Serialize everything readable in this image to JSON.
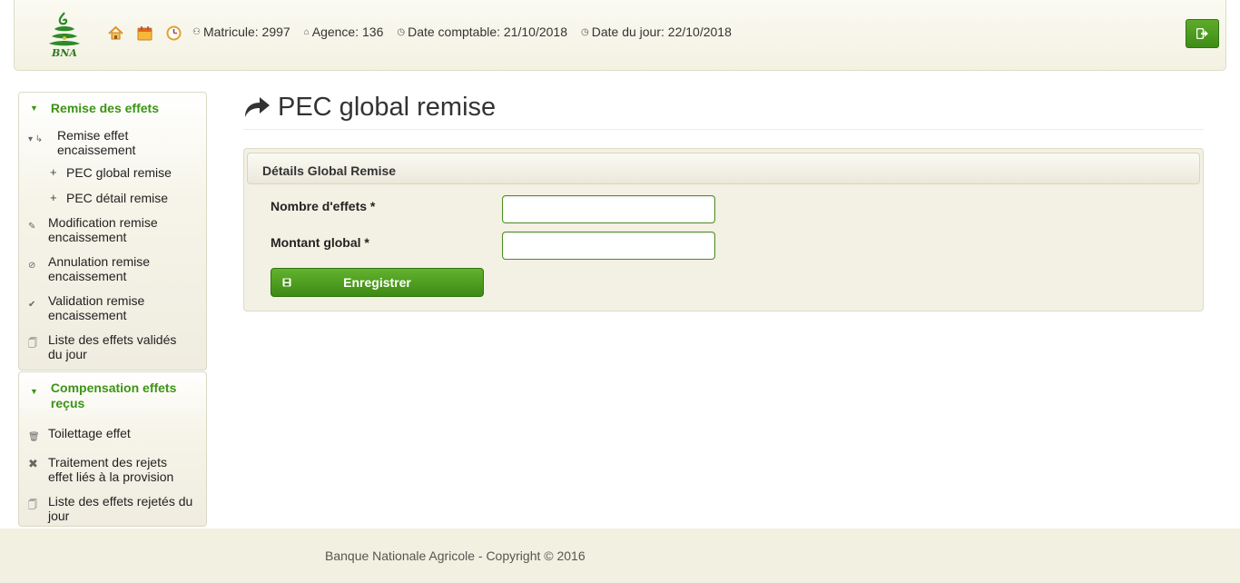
{
  "header": {
    "logo_text": "BNA",
    "icons": [
      "home-icon",
      "calendar-icon",
      "clock-icon"
    ],
    "info": [
      {
        "icon": "user-icon",
        "text": "Matricule: 2997"
      },
      {
        "icon": "bank-icon",
        "text": "Agence: 136"
      },
      {
        "icon": "clock-icon",
        "text": "Date comptable: 21/10/2018"
      },
      {
        "icon": "clock-icon",
        "text": "Date du jour: 22/10/2018"
      }
    ],
    "logout_icon": "logout-icon"
  },
  "sidebar": {
    "section1": {
      "title": "Remise des effets",
      "item_remise": "Remise effet encaissement",
      "sub_global": "PEC global remise",
      "sub_detail": "PEC détail remise",
      "item_modification": "Modification remise encaissement",
      "item_annulation": "Annulation remise encaissement",
      "item_validation": "Validation remise encaissement",
      "item_liste": "Liste des effets validés du jour"
    },
    "section2": {
      "title": "Compensation effets reçus",
      "item_toilettage": "Toilettage effet",
      "item_traitement": "Traitement des rejets effet liés à la provision",
      "item_liste_rejetes": "Liste des effets rejetés du jour"
    }
  },
  "main": {
    "title": "PEC global remise",
    "panel_title": "Détails Global Remise",
    "field_nombre_label": "Nombre d'effets  *",
    "field_nombre_value": "",
    "field_montant_label": "Montant global  *",
    "field_montant_value": "",
    "save_label": "Enregistrer"
  },
  "footer": {
    "copyright": "Banque Nationale Agricole - Copyright © 2016"
  },
  "colors": {
    "accent_green": "#3c9414",
    "button_green": "#4e9e1f",
    "panel_beige": "#f3f1e3"
  }
}
